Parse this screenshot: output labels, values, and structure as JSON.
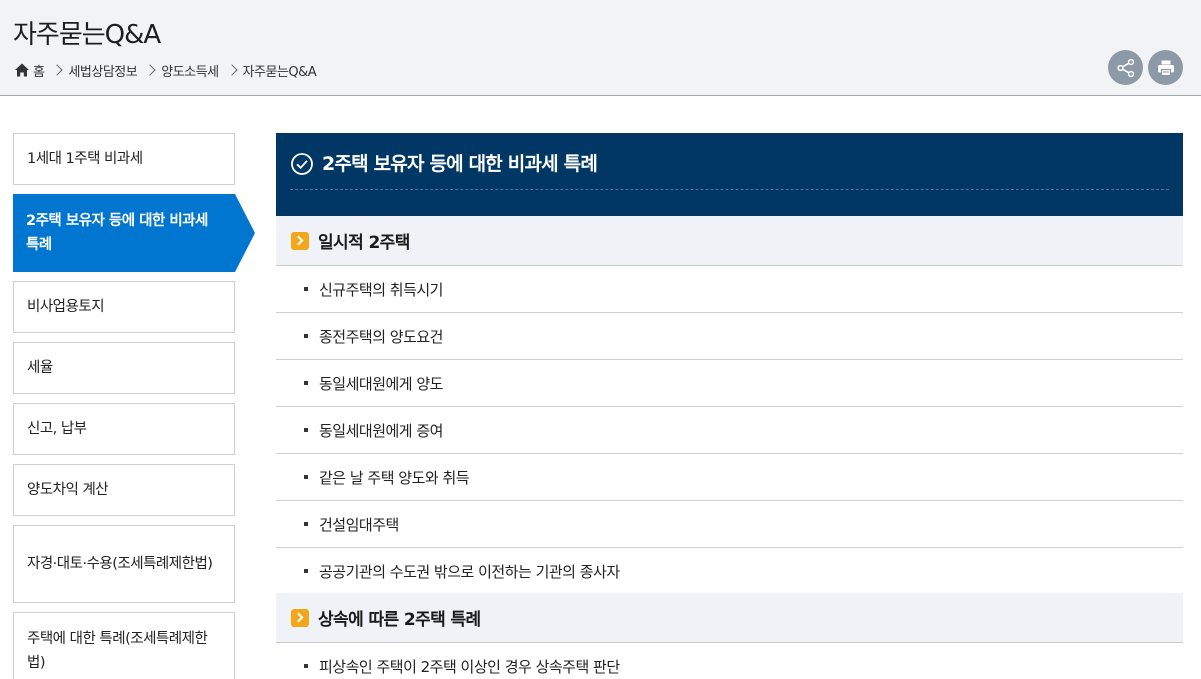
{
  "page": {
    "title": "자주묻는Q&A"
  },
  "breadcrumb": {
    "home_label": "홈",
    "items": [
      "세법상담정보",
      "양도소득세",
      "자주묻는Q&A"
    ]
  },
  "tools": {
    "share_icon": "share-icon",
    "print_icon": "print-icon"
  },
  "sidebar": {
    "items": [
      {
        "label": "1세대 1주택 비과세"
      },
      {
        "label": "2주택 보유자 등에 대한 비과세 특례"
      },
      {
        "label": "비사업용토지"
      },
      {
        "label": "세율"
      },
      {
        "label": "신고, 납부"
      },
      {
        "label": "양도차익 계산"
      },
      {
        "label": "자경·대토·수용(조세특례제한법)"
      },
      {
        "label": "주택에 대한 특례(조세특례제한법)"
      }
    ],
    "active_index": 1
  },
  "content": {
    "heading": "2주택 보유자 등에 대한 비과세 특례",
    "sections": [
      {
        "title": "일시적 2주택",
        "items": [
          "신규주택의 취득시기",
          "종전주택의 양도요건",
          "동일세대원에게 양도",
          "동일세대원에게 증여",
          "같은 날 주택 양도와 취득",
          "건설임대주택",
          "공공기관의 수도권 밖으로 이전하는 기관의 종사자"
        ]
      },
      {
        "title": "상속에 따른 2주택 특례",
        "items": [
          "피상속인 주택이 2주택 이상인 경우 상속주택 판단"
        ]
      }
    ]
  },
  "colors": {
    "active_menu": "#0076d1",
    "heading_bg": "#003764",
    "section_arrow": "#f2a71a",
    "tool_button": "#8c99a6"
  }
}
